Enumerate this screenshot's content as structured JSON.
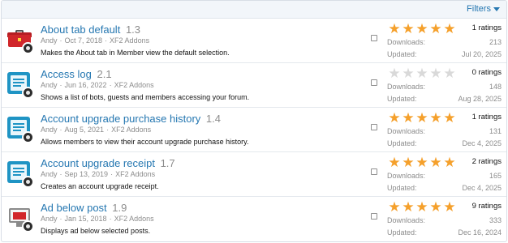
{
  "filters": {
    "label": "Filters"
  },
  "labels": {
    "downloads": "Downloads:",
    "updated": "Updated:"
  },
  "addons": [
    {
      "title": "About tab default",
      "version": "1.3",
      "author": "Andy",
      "date": "Oct 7, 2018",
      "category": "XF2 Addons",
      "description": "Makes the About tab in Member view the default selection.",
      "stars": 5,
      "ratings": "1 ratings",
      "downloads": "213",
      "updated": "Jul 20, 2025",
      "icon": "toolbox-icon"
    },
    {
      "title": "Access log",
      "version": "2.1",
      "author": "Andy",
      "date": "Jun 16, 2022",
      "category": "XF2 Addons",
      "description": "Shows a list of bots, guests and members accessing your forum.",
      "stars": 0,
      "ratings": "0 ratings",
      "downloads": "148",
      "updated": "Aug 28, 2025",
      "icon": "document-icon"
    },
    {
      "title": "Account upgrade purchase history",
      "version": "1.4",
      "author": "Andy",
      "date": "Aug 5, 2021",
      "category": "XF2 Addons",
      "description": "Allows members to view their account upgrade purchase history.",
      "stars": 5,
      "ratings": "1 ratings",
      "downloads": "131",
      "updated": "Dec 4, 2025",
      "icon": "document-icon"
    },
    {
      "title": "Account upgrade receipt",
      "version": "1.7",
      "author": "Andy",
      "date": "Sep 13, 2019",
      "category": "XF2 Addons",
      "description": "Creates an account upgrade receipt.",
      "stars": 5,
      "ratings": "2 ratings",
      "downloads": "165",
      "updated": "Dec 4, 2025",
      "icon": "document-icon"
    },
    {
      "title": "Ad below post",
      "version": "1.9",
      "author": "Andy",
      "date": "Jan 15, 2018",
      "category": "XF2 Addons",
      "description": "Displays ad below selected posts.",
      "stars": 5,
      "ratings": "9 ratings",
      "downloads": "333",
      "updated": "Dec 16, 2024",
      "icon": "ad-screen-icon"
    }
  ],
  "colors": {
    "link": "#2577b1",
    "star": "#f5a02b",
    "star_empty": "#d9d9d9",
    "muted": "#8c8c8c"
  }
}
